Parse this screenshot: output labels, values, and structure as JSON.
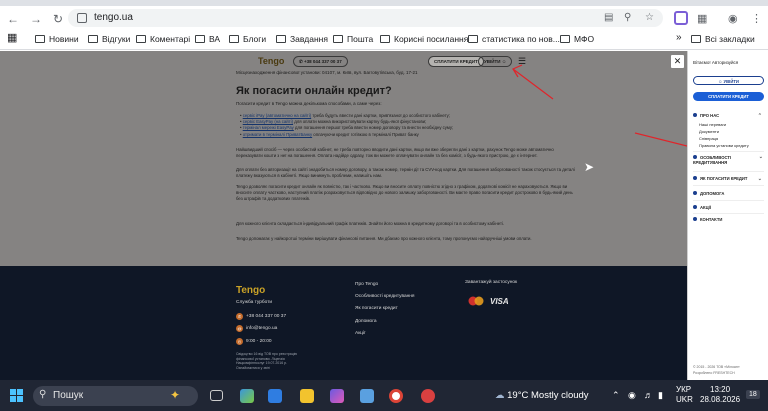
{
  "browser": {
    "url": "tengo.ua",
    "bookmarks": [
      "Новини",
      "Відгуки",
      "Коментарі",
      "ВА",
      "Блоги",
      "Завдання",
      "Пошта",
      "Корисні посилання",
      "статистика по нов...",
      "МФО"
    ],
    "all_bookmarks": "Всі закладки",
    "more": "»"
  },
  "site": {
    "logo": "Tengo",
    "phone": "+38 044 337 00 37",
    "pay_button": "СПЛАТИТИ КРЕДИТ",
    "login_button": "УВІЙТИ",
    "address_line": "Місцезнаходження фінансової установи: 04107, м. Київ, вул. Багговутівська, буд. 17-21",
    "heading": "Як погасити онлайн кредит?",
    "intro": "Погасити кредит в Tengo можна декількома способами, а саме через:",
    "ways": [
      {
        "link": "сервіс iPay (автоматично на сайті)",
        "rest": " треба будуть ввести дані картки, прив'язаної до особистого кабінету;"
      },
      {
        "link": "сервіс EasyPay (на сайті)",
        "rest": " для оплати можна використовувати картку будь-якої фінустанови;"
      },
      {
        "link": "термінал мережі EasyPay",
        "rest": " для погашення першої треба ввести номер договору та внести необхідну суму;"
      },
      {
        "link": "отримати в терміналі ПриватБанку",
        "rest": " оплачуючи кредит готівкою в терміналі Приват банку"
      }
    ],
    "para1": "Найшвидший спосіб — через особистий кабінет, не треба повторно вводити дані картки, якщо ви вже зберегли дані з картки, рахунок Tengo може автоматично переказувати кошти з неї на погашення. Оплата надійде одразу, тож ви можете оплачувати онлайн та без комісії, з будь-якого пристрою, де є інтернет.",
    "para2": "Для оплати без авторизації на сайті знадобиться номер договору, а також номер, термін дії та CVV-код картки. Для погашення заборгованості також стосується та деталі платежу вказуються в кабінеті. Якщо виникнуть проблеми, напишіть нам.",
    "para3": "Tengo дозволяє погасити кредит онлайн як повністю, так і частково. Якщо ви вносите оплату повністю згідно з графіком, додаткові комісії не нараховуються. Якщо ви вносите оплату частково, наступний платіж розраховується відповідно до нового залишку заборгованості. Ви маєте право погасити кредит достроково в будь-який день без штрафів та додаткових платежів.",
    "para4": "Для кожного клієнта складається індивідуальний графік платежів. Знайти його можна в кредитному договорі та в особистому кабінеті.",
    "para5": "Tengo допомагає у найкоротші терміни вирішувати фінансові питання. Ми дбаємо про кожного клієнта, тому пропонуємо найзручніші умови оплати.",
    "footer": {
      "logo": "Tengo",
      "support_title": "Служба турботи",
      "phone": "+38 044 337 00 37",
      "email": "info@tengo.ua",
      "hours": "9:00 - 20:00",
      "small_print": "Свідоцтво 16 від ТОВ про реєстрацію фінансової установи. Ліцензія Нацкомфінпослуг 19.07.2016 р. Ознайомитися у звіті",
      "links": [
        "Про Tengo",
        "Особливості кредитування",
        "Як погасити кредит",
        "Допомога",
        "Акції"
      ],
      "apps_title": "Завантажуй застосунок",
      "visa": "VISA"
    }
  },
  "panel": {
    "greeting": "Вітаємо! Авторизуйся",
    "login": "УВІЙТИ",
    "pay": "СПЛАТИТИ КРЕДИТ",
    "about": "ПРО НАС",
    "about_items": [
      "Наші переваги",
      "Документи",
      "Співпраця",
      "Правила установи кредиту"
    ],
    "sections": [
      "ОСОБЛИВОСТІ КРЕДИТУВАННЯ",
      "ЯК ПОГАСИТИ КРЕДИТ",
      "ДОПОМОГА",
      "АКЦІЇ",
      "КОНТАКТИ"
    ],
    "copyright": "© 2015 - 2026 ТОВ «Мілоан»",
    "dev": "Розроблено FRESHTECH"
  },
  "taskbar": {
    "search": "Пошук",
    "weather": "19°C  Mostly cloudy",
    "lang_top": "УКР",
    "lang_bottom": "UKR",
    "time": "13:20",
    "date": "28.08.2026",
    "notif": "18"
  }
}
